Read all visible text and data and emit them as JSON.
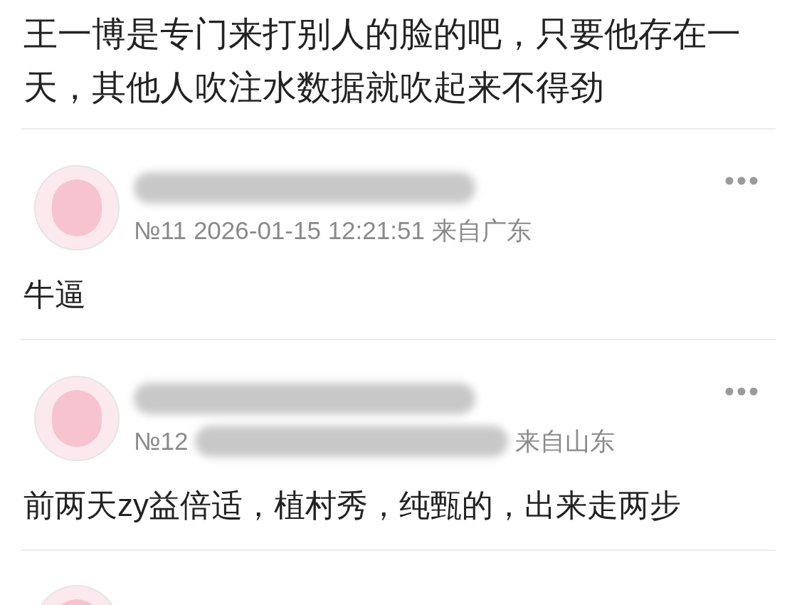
{
  "lead_body": "王一博是专门来打别人的脸的吧，只要他存在一天，其他人吹注水数据就吹起来不得劲",
  "comments": [
    {
      "number": "№11",
      "time": "2026-01-15 12:21:51",
      "location": "来自广东",
      "body": "牛逼"
    },
    {
      "number": "№12",
      "location": "来自山东",
      "body": "前两天zy益倍适，植村秀，纯甄的，出来走两步"
    }
  ],
  "next_comment_peek": true
}
